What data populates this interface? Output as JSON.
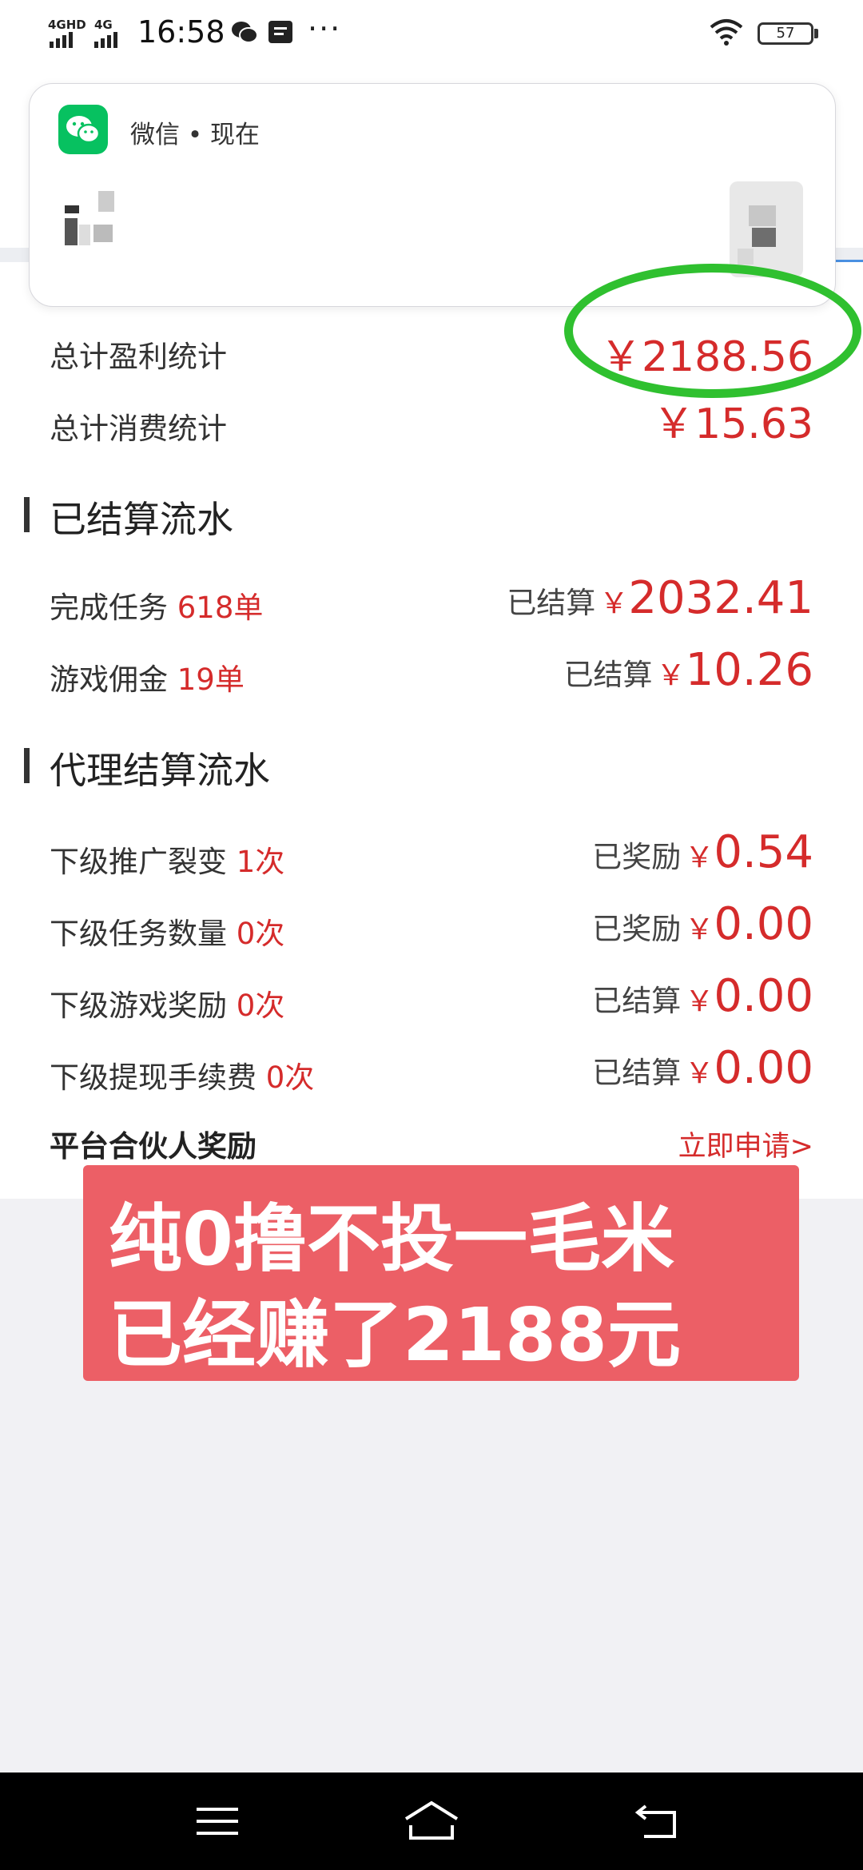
{
  "status_bar": {
    "sim1": "4GHD",
    "sim2": "4G",
    "time": "16:58",
    "battery": "57",
    "more": "···"
  },
  "notification": {
    "app": "微信 • 现在",
    "icon": "wechat-icon"
  },
  "stats": {
    "profit_label": "总计盈利统计",
    "profit_value": "￥2188.56",
    "consume_label": "总计消费统计",
    "consume_value": "￥15.63"
  },
  "settled": {
    "title": "已结算流水",
    "rows": [
      {
        "label": "完成任务",
        "count": "618单",
        "prefix": "已结算",
        "yen": "￥",
        "amount": "2032.41"
      },
      {
        "label": "游戏佣金",
        "count": "19单",
        "prefix": "已结算",
        "yen": "￥",
        "amount": "10.26"
      }
    ]
  },
  "agent": {
    "title": "代理结算流水",
    "rows": [
      {
        "label": "下级推广裂变",
        "count": "1次",
        "prefix": "已奖励",
        "yen": "￥",
        "amount": "0.54"
      },
      {
        "label": "下级任务数量",
        "count": "0次",
        "prefix": "已奖励",
        "yen": "￥",
        "amount": "0.00"
      },
      {
        "label": "下级游戏奖励",
        "count": "0次",
        "prefix": "已结算",
        "yen": "￥",
        "amount": "0.00"
      },
      {
        "label": "下级提现手续费",
        "count": "0次",
        "prefix": "已结算",
        "yen": "￥",
        "amount": "0.00"
      }
    ]
  },
  "partner": {
    "label": "平台合伙人奖励",
    "link": "立即申请>"
  },
  "banner": {
    "line1": "纯0撸不投一毛米",
    "line2": "已经赚了2188元"
  },
  "colors": {
    "accent_red": "#d52b2b",
    "annotation_green": "#2fc02f",
    "banner_bg": "#ec5f66",
    "wechat_green": "#07c160"
  }
}
